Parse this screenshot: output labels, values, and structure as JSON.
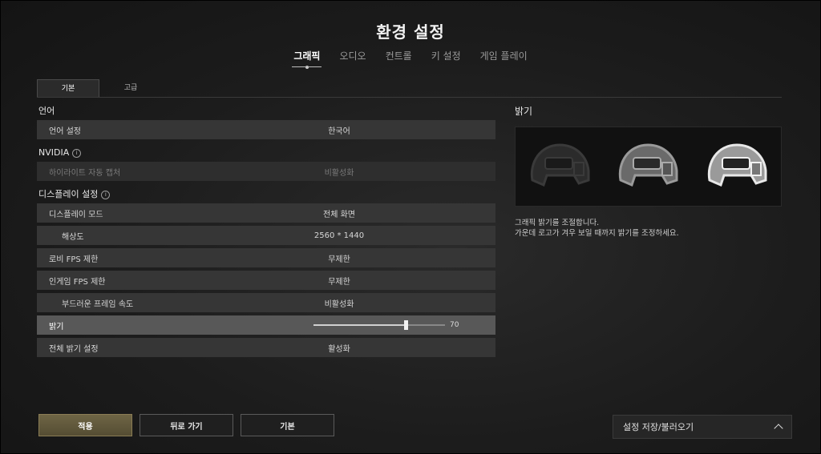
{
  "title": "환경 설정",
  "main_tabs": [
    {
      "label": "그래픽",
      "active": true
    },
    {
      "label": "오디오",
      "active": false
    },
    {
      "label": "컨트롤",
      "active": false
    },
    {
      "label": "키 설정",
      "active": false
    },
    {
      "label": "게임 플레이",
      "active": false
    }
  ],
  "sub_tabs": [
    {
      "label": "기본",
      "active": true
    },
    {
      "label": "고급",
      "active": false
    }
  ],
  "sections": {
    "language": {
      "header": "언어",
      "rows": [
        {
          "label": "언어 설정",
          "value": "한국어"
        }
      ]
    },
    "nvidia": {
      "header": "NVIDIA",
      "rows": [
        {
          "label": "하이라이트 자동 캡처",
          "value": "비활성화"
        }
      ]
    },
    "display": {
      "header": "디스플레이 설정",
      "rows": [
        {
          "label": "디스플레이 모드",
          "value": "전체 화면"
        },
        {
          "label": "해상도",
          "value": "2560 * 1440"
        },
        {
          "label": "로비 FPS 제한",
          "value": "무제한"
        },
        {
          "label": "인게임 FPS 제한",
          "value": "무제한"
        },
        {
          "label": "부드러운 프레임 속도",
          "value": "비활성화"
        },
        {
          "label": "밝기",
          "value": "70"
        },
        {
          "label": "전체 밝기 설정",
          "value": "활성화"
        }
      ],
      "brightness_level": 70,
      "brightness_max": 100
    }
  },
  "preview": {
    "title": "밝기",
    "description_line1": "그래픽 밝기를 조절합니다.",
    "description_line2": "가운데 로고가 겨우 보일 때까지 밝기를 조정하세요."
  },
  "buttons": {
    "apply": "적용",
    "back": "뒤로 가기",
    "default": "기본"
  },
  "save_load": "설정 저장/불러오기",
  "colors": {
    "accent_gold": "#6f6545",
    "row_bg": "#363636",
    "row_highlight": "#585858"
  }
}
